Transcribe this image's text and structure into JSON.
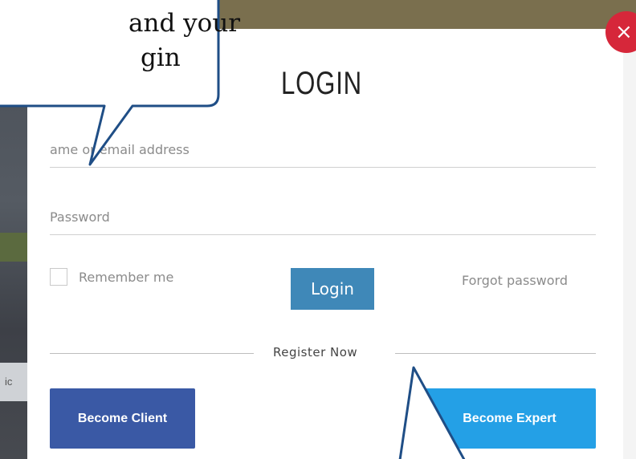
{
  "modal": {
    "title": "LOGIN",
    "username_placeholder": "ame or email address",
    "password_placeholder": "Password",
    "remember_label": "Remember me",
    "login_label": "Login",
    "forgot_label": "Forgot password",
    "divider_label": "Register Now",
    "become_client_label": "Become Client",
    "become_expert_label": "Become Expert",
    "close_glyph": "×"
  },
  "callout": {
    "line1": "and your",
    "line2": "gin"
  },
  "background": {
    "left_tab_text": "ic"
  },
  "colors": {
    "client_button": "#3a59a5",
    "expert_button": "#24a0e6",
    "login_button": "#3f88b8",
    "close_button": "#d6273a",
    "callout_border": "#1f4e86"
  }
}
